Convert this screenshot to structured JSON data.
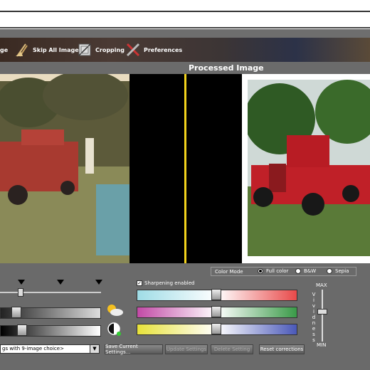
{
  "toolbar": {
    "partial_label": "ge",
    "skip_all_label": "Skip All Images",
    "cropping_label": "Cropping",
    "preferences_label": "Preferences"
  },
  "processed_title": "Processed Image",
  "color_mode": {
    "label": "Color Mode",
    "options": [
      "Full color",
      "B&W",
      "Sepia"
    ],
    "selected": "Full color"
  },
  "sharpening": {
    "label": "Sharpening enabled",
    "checked": true
  },
  "vividness": {
    "max_label": "MAX",
    "min_label": "MIN",
    "letters": [
      "V",
      "i",
      "v",
      "i",
      "d",
      "n",
      "e",
      "s",
      "s"
    ]
  },
  "preset_select": {
    "value": "gs with 9-image choice>"
  },
  "buttons": {
    "save": "Save Current Settings...",
    "update": "Update Settings",
    "delete": "Delete Setting",
    "reset": "Reset corrections"
  },
  "colors": {
    "divider": "#f2d21c",
    "cyan_red_left": "#9fdce6",
    "cyan_red_right": "#e84a4a",
    "magenta_green_left": "#c24aa6",
    "magenta_green_right": "#3a9a48",
    "yellow_blue_left": "#e8e23a",
    "yellow_blue_right": "#4a58b8"
  }
}
